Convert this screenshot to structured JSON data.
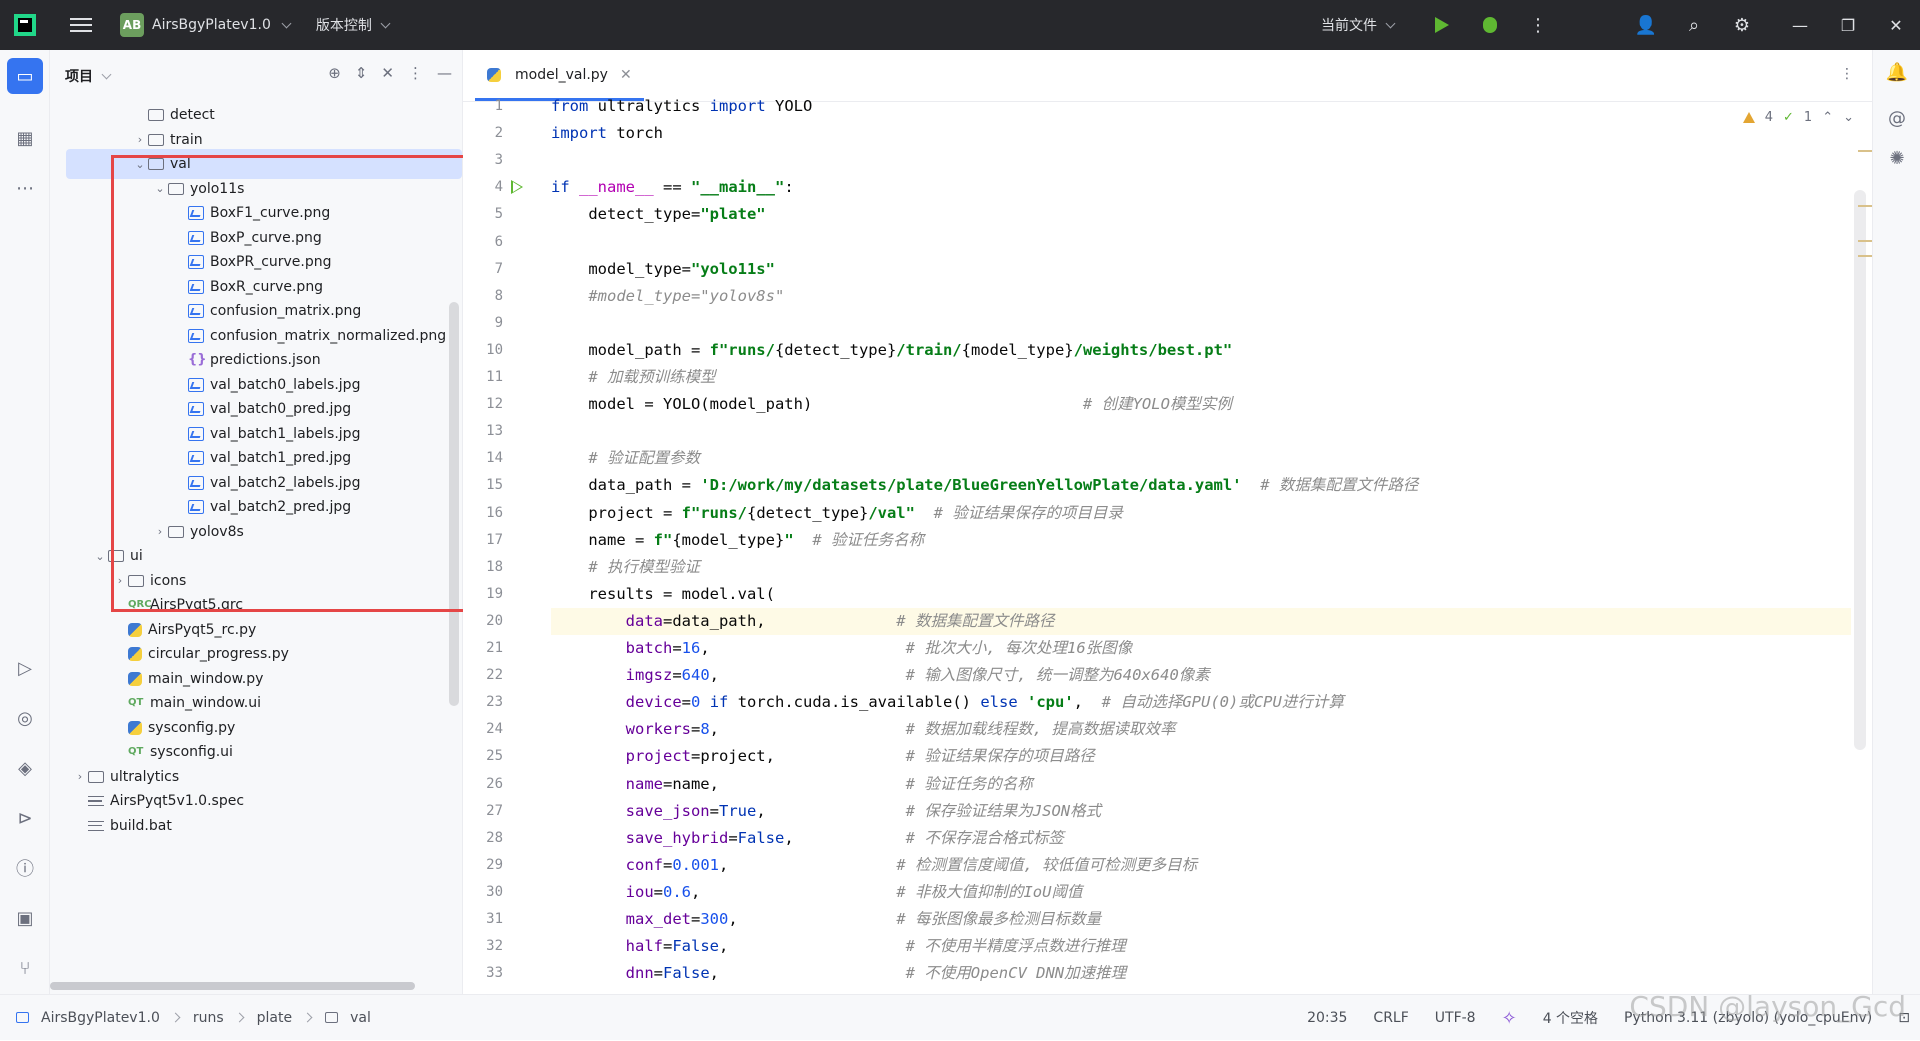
{
  "titlebar": {
    "project_badge": "AB",
    "project_name": "AirsBgyPlatev1.0",
    "vcs_label": "版本控制",
    "run_config": "当前文件"
  },
  "project_panel": {
    "title": "项目",
    "tree": [
      {
        "label": "detect",
        "type": "folder",
        "depth": 4,
        "arrow": ""
      },
      {
        "label": "train",
        "type": "folder",
        "depth": 4,
        "arrow": "right"
      },
      {
        "label": "val",
        "type": "folder",
        "depth": 4,
        "arrow": "down",
        "selected": true
      },
      {
        "label": "yolo11s",
        "type": "folder",
        "depth": 5,
        "arrow": "down"
      },
      {
        "label": "BoxF1_curve.png",
        "type": "image",
        "depth": 6
      },
      {
        "label": "BoxP_curve.png",
        "type": "image",
        "depth": 6
      },
      {
        "label": "BoxPR_curve.png",
        "type": "image",
        "depth": 6
      },
      {
        "label": "BoxR_curve.png",
        "type": "image",
        "depth": 6
      },
      {
        "label": "confusion_matrix.png",
        "type": "image",
        "depth": 6
      },
      {
        "label": "confusion_matrix_normalized.png",
        "type": "image",
        "depth": 6
      },
      {
        "label": "predictions.json",
        "type": "json",
        "depth": 6
      },
      {
        "label": "val_batch0_labels.jpg",
        "type": "image",
        "depth": 6
      },
      {
        "label": "val_batch0_pred.jpg",
        "type": "image",
        "depth": 6
      },
      {
        "label": "val_batch1_labels.jpg",
        "type": "image",
        "depth": 6
      },
      {
        "label": "val_batch1_pred.jpg",
        "type": "image",
        "depth": 6
      },
      {
        "label": "val_batch2_labels.jpg",
        "type": "image",
        "depth": 6
      },
      {
        "label": "val_batch2_pred.jpg",
        "type": "image",
        "depth": 6
      },
      {
        "label": "yolov8s",
        "type": "folder",
        "depth": 5,
        "arrow": "right"
      },
      {
        "label": "ui",
        "type": "folder",
        "depth": 2,
        "arrow": "down"
      },
      {
        "label": "icons",
        "type": "folder",
        "depth": 3,
        "arrow": "right"
      },
      {
        "label": "AirsPyqt5.qrc",
        "type": "qrc",
        "depth": 3
      },
      {
        "label": "AirsPyqt5_rc.py",
        "type": "python",
        "depth": 3
      },
      {
        "label": "circular_progress.py",
        "type": "python",
        "depth": 3
      },
      {
        "label": "main_window.py",
        "type": "python",
        "depth": 3
      },
      {
        "label": "main_window.ui",
        "type": "qtui",
        "depth": 3
      },
      {
        "label": "sysconfig.py",
        "type": "python",
        "depth": 3
      },
      {
        "label": "sysconfig.ui",
        "type": "qtui",
        "depth": 3
      },
      {
        "label": "ultralytics",
        "type": "folder",
        "depth": 1,
        "arrow": "right"
      },
      {
        "label": "AirsPyqt5v1.0.spec",
        "type": "spec",
        "depth": 1
      },
      {
        "label": "build.bat",
        "type": "spec",
        "depth": 1
      }
    ]
  },
  "editor": {
    "tab_label": "model_val.py",
    "warnings_count": "4",
    "ok_count": "1",
    "lines": [
      {
        "n": "1",
        "html": "<span class='kw'>from</span> ultralytics <span class='kw'>import</span> YOLO"
      },
      {
        "n": "2",
        "html": "<span class='kw'>import</span> torch"
      },
      {
        "n": "3",
        "html": ""
      },
      {
        "n": "4",
        "html": "<span class='kw'>if</span> <span class='dunder'>__name__</span> == <span class='strb'>\"__main__\"</span>:",
        "run": true
      },
      {
        "n": "5",
        "html": "    detect_type=<span class='strb'>\"plate\"</span>"
      },
      {
        "n": "6",
        "html": ""
      },
      {
        "n": "7",
        "html": "    model_type=<span class='strb'>\"yolo11s\"</span>"
      },
      {
        "n": "8",
        "html": "    <span class='cm'>#model_type=\"yolov8s\"</span>"
      },
      {
        "n": "9",
        "html": ""
      },
      {
        "n": "10",
        "html": "    model_path = <span class='strb'>f\"runs/</span>{detect_type}<span class='strb'>/train/</span>{model_type}<span class='strb'>/weights/best.pt\"</span>"
      },
      {
        "n": "11",
        "html": "    <span class='cm'># 加载预训练模型</span>"
      },
      {
        "n": "12",
        "html": "    model = YOLO(model_path)                             <span class='cm'># 创建YOLO模型实例</span>"
      },
      {
        "n": "13",
        "html": ""
      },
      {
        "n": "14",
        "html": "    <span class='cm'># 验证配置参数</span>"
      },
      {
        "n": "15",
        "html": "    data_path = <span class='strb'>'D:/work/my/datasets/plate/BlueGreenYellowPlate/data.yaml'</span>  <span class='cm'># 数据集配置文件路径</span>"
      },
      {
        "n": "16",
        "html": "    project = <span class='strb'>f\"runs/</span>{detect_type}<span class='strb'>/val\"</span>  <span class='cm'># 验证结果保存的项目目录</span>"
      },
      {
        "n": "17",
        "html": "    name = <span class='strb'>f\"</span>{model_type}<span class='strb'>\"</span>  <span class='cm'># 验证任务名称</span>"
      },
      {
        "n": "18",
        "html": "    <span class='cm'># 执行模型验证</span>"
      },
      {
        "n": "19",
        "html": "    results = model.val("
      },
      {
        "n": "20",
        "html": "        <span class='prm'>data</span>=data_path,              <span class='cm'># 数据集配置文件路径</span>",
        "hl": true
      },
      {
        "n": "21",
        "html": "        <span class='prm'>batch</span>=<span class='num'>16</span>,                     <span class='cm'># 批次大小, 每次处理16张图像</span>"
      },
      {
        "n": "22",
        "html": "        <span class='prm'>imgsz</span>=<span class='num'>640</span>,                    <span class='cm'># 输入图像尺寸, 统一调整为640x640像素</span>"
      },
      {
        "n": "23",
        "html": "        <span class='prm'>device</span>=<span class='num'>0</span> <span class='kw'>if</span> torch.cuda.is_available() <span class='kw'>else</span> <span class='strb'>'cpu'</span>,  <span class='cm'># 自动选择GPU(0)或CPU进行计算</span>"
      },
      {
        "n": "24",
        "html": "        <span class='prm'>workers</span>=<span class='num'>8</span>,                    <span class='cm'># 数据加载线程数, 提高数据读取效率</span>"
      },
      {
        "n": "25",
        "html": "        <span class='prm'>project</span>=project,              <span class='cm'># 验证结果保存的项目路径</span>"
      },
      {
        "n": "26",
        "html": "        <span class='prm'>name</span>=name,                    <span class='cm'># 验证任务的名称</span>"
      },
      {
        "n": "27",
        "html": "        <span class='prm'>save_json</span>=<span class='kw'>True</span>,               <span class='cm'># 保存验证结果为JSON格式</span>"
      },
      {
        "n": "28",
        "html": "        <span class='prm'>save_hybrid</span>=<span class='kw'>False</span>,            <span class='cm'># 不保存混合格式标签</span>"
      },
      {
        "n": "29",
        "html": "        <span class='prm'>conf</span>=<span class='num'>0.001</span>,                  <span class='cm'># 检测置信度阈值, 较低值可检测更多目标</span>"
      },
      {
        "n": "30",
        "html": "        <span class='prm'>iou</span>=<span class='num'>0.6</span>,                     <span class='cm'># 非极大值抑制的IoU阈值</span>"
      },
      {
        "n": "31",
        "html": "        <span class='prm'>max_det</span>=<span class='num'>300</span>,                 <span class='cm'># 每张图像最多检测目标数量</span>"
      },
      {
        "n": "32",
        "html": "        <span class='prm'>half</span>=<span class='kw'>False</span>,                   <span class='cm'># 不使用半精度浮点数进行推理</span>"
      },
      {
        "n": "33",
        "html": "        <span class='prm'>dnn</span>=<span class='kw'>False</span>,                    <span class='cm'># 不使用OpenCV DNN加速推理</span>"
      }
    ]
  },
  "statusbar": {
    "crumbs": [
      "AirsBgyPlatev1.0",
      "runs",
      "plate",
      "val"
    ],
    "position": "20:35",
    "line_sep": "CRLF",
    "encoding": "UTF-8",
    "indent": "4 个空格",
    "interpreter": "Python 3.11 (zbyolo) (yolo_cpuEnv)"
  },
  "watermark": "CSDN @layson_Gcd",
  "colors": {
    "accent": "#3574f0",
    "highlight_box": "#e54646",
    "run_green": "#5fb832"
  }
}
